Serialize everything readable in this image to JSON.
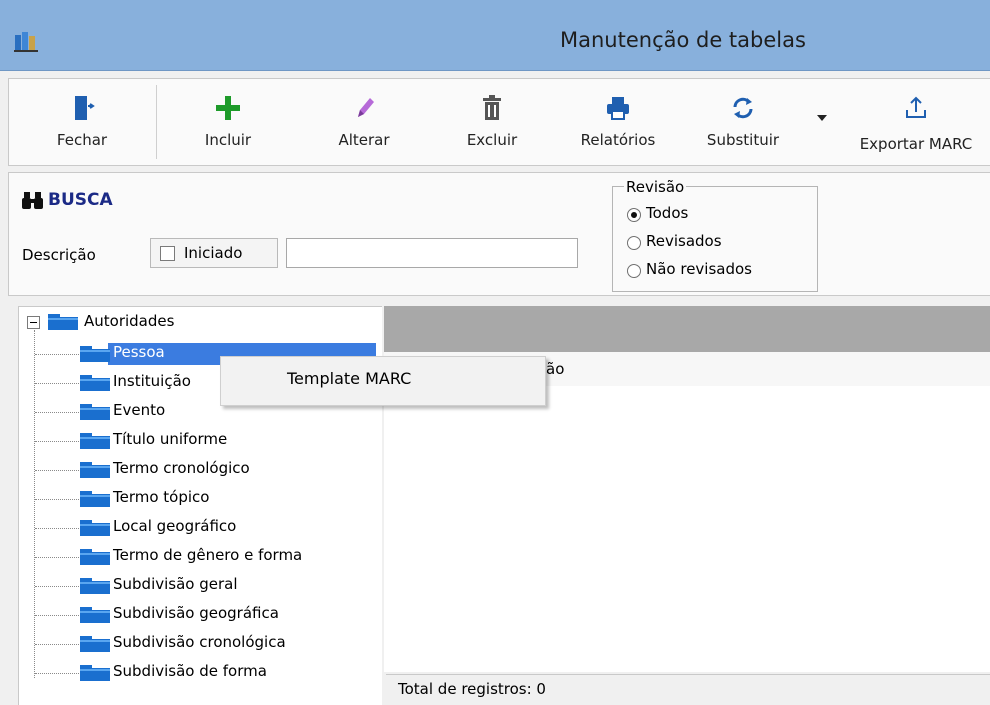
{
  "window": {
    "title": "Manutenção de tabelas"
  },
  "toolbar": {
    "buttons": [
      {
        "label": "Fechar",
        "icon": "door-exit-icon"
      },
      {
        "label": "Incluir",
        "icon": "plus-icon"
      },
      {
        "label": "Alterar",
        "icon": "pencil-icon"
      },
      {
        "label": "Excluir",
        "icon": "trash-icon"
      },
      {
        "label": "Relatórios",
        "icon": "printer-icon"
      },
      {
        "label": "Substituir",
        "icon": "refresh-icon"
      },
      {
        "label": "Exportar MARC",
        "icon": "upload-icon"
      }
    ]
  },
  "search": {
    "title": "BUSCA",
    "description_label": "Descrição",
    "starts_with_label": "Iniciado",
    "starts_with_checked": false,
    "description_value": "",
    "review": {
      "legend": "Revisão",
      "options": [
        "Todos",
        "Revisados",
        "Não revisados"
      ],
      "selected": "Todos"
    }
  },
  "tree": {
    "root": "Autoridades",
    "children": [
      "Pessoa",
      "Instituição",
      "Evento",
      "Título uniforme",
      "Termo cronológico",
      "Termo tópico",
      "Local geográfico",
      "Termo de gênero e forma",
      "Subdivisão geral",
      "Subdivisão geográfica",
      "Subdivisão cronológica",
      "Subdivisão de forma"
    ],
    "selected": "Pessoa"
  },
  "grid": {
    "column_fragment": "ão"
  },
  "status": {
    "total": "Total de registros: 0"
  },
  "context_menu": {
    "items": [
      "Template MARC"
    ]
  },
  "colors": {
    "titlebar": "#88b0dc",
    "selection": "#3b7ce0",
    "folder": "#1a6fcf",
    "busca": "#1b2a86"
  }
}
